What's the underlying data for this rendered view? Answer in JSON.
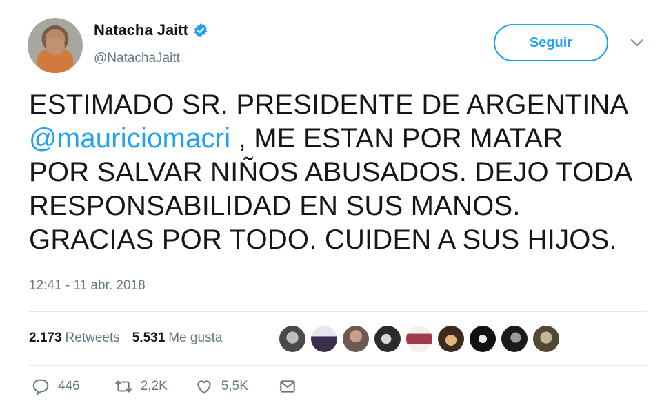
{
  "author": {
    "name": "Natacha Jaitt",
    "handle": "@NatachaJaitt",
    "verified": true
  },
  "follow_button": {
    "label": "Seguir"
  },
  "tweet": {
    "lines": [
      "ESTIMADO SR. PRESIDENTE DE ARGENTINA",
      "",
      "POR SALVAR NIÑOS ABUSADOS. DEJO TODA",
      "RESPONSABILIDAD EN SUS MANOS.",
      "GRACIAS POR TODO. CUIDEN A SUS HIJOS."
    ],
    "mention": "@mauriciomacri",
    "line2_rest": " , ME ESTAN POR MATAR",
    "timestamp": "12:41 - 11 abr. 2018"
  },
  "stats": {
    "retweets_count": "2.173",
    "retweets_label": "Retweets",
    "likes_count": "5.531",
    "likes_label": "Me gusta"
  },
  "likers": [
    {
      "icon": "user-avatar-1"
    },
    {
      "icon": "user-avatar-2"
    },
    {
      "icon": "user-avatar-3"
    },
    {
      "icon": "user-avatar-4"
    },
    {
      "icon": "user-avatar-5"
    },
    {
      "icon": "user-avatar-6"
    },
    {
      "icon": "user-avatar-7"
    },
    {
      "icon": "user-avatar-8"
    },
    {
      "icon": "user-avatar-9"
    }
  ],
  "actions": {
    "reply_count": "446",
    "retweet_count": "2,2K",
    "like_count": "5,5K"
  },
  "colors": {
    "accent": "#1da1f2",
    "text": "#14171a",
    "muted": "#657786",
    "divider": "#e1e8ed"
  }
}
